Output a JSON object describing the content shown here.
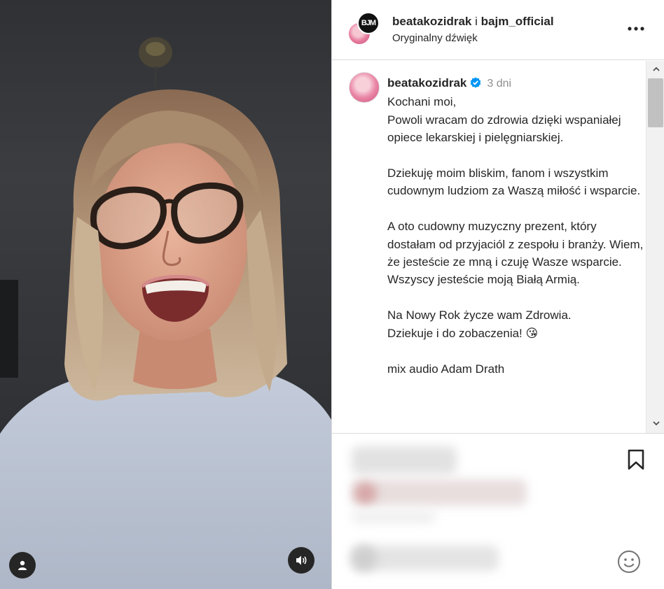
{
  "header": {
    "user1": "beatakozidrak",
    "separator": "i",
    "user2": "bajm_official",
    "audio": "Oryginalny dźwięk",
    "logo_text": "BJM",
    "more_icon": "more-horizontal-icon"
  },
  "caption": {
    "username": "beatakozidrak",
    "time": "3 dni",
    "text": "Kochani moi,\nPowoli wracam do zdrowia dzięki wspaniałej opiece lekarskiej i pielęgniarskiej.\n\nDziekuję moim bliskim, fanom i wszystkim cudownym ludziom za Waszą miłość i wsparcie.\n\nA oto cudowny muzyczny prezent, który dostałam od przyjaciól z zespołu i branży. Wiem, że jesteście ze mną i czuję Wasze wsparcie.\nWszyscy jesteście moją Białą Armią.\n\nNa Nowy Rok życze wam Zdrowia.\nDziekuje i do zobaczenia! 😘\n\nmix audio Adam Drath",
    "verified_color": "#0095f6"
  },
  "icons": {
    "bookmark": "bookmark-icon",
    "emoji": "smiley-icon",
    "user_tag": "user-tag-icon",
    "sound": "speaker-icon"
  }
}
